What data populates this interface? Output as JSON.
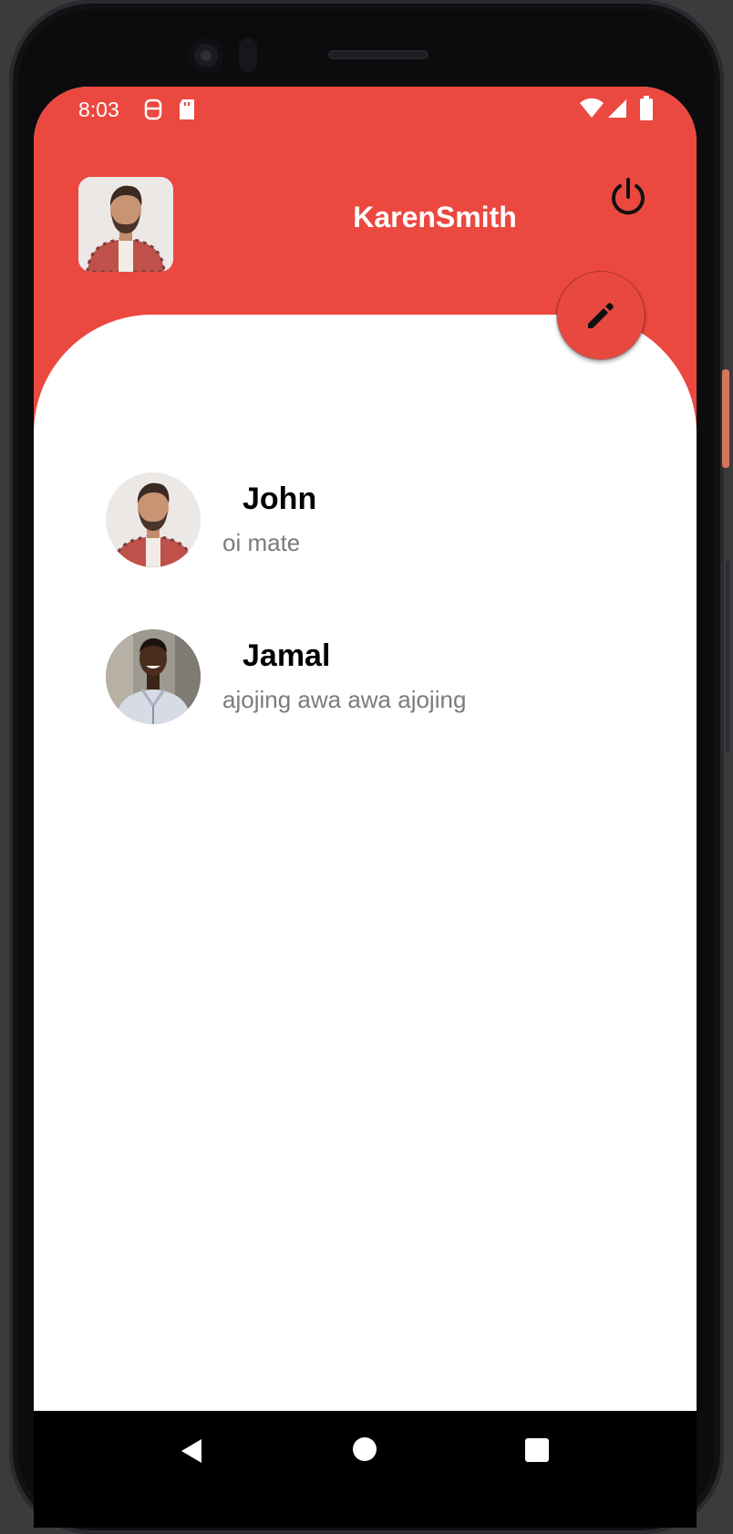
{
  "status_bar": {
    "time": "8:03",
    "left_icons": [
      "sim-toolkit-icon",
      "sd-card-icon"
    ],
    "right_icons": [
      "wifi-icon",
      "cell-signal-icon",
      "battery-icon"
    ]
  },
  "header": {
    "username": "KarenSmith",
    "avatar_icon": "profile-photo",
    "logout_icon": "power-icon",
    "accent_color": "#eb4840"
  },
  "fab": {
    "icon": "edit-pencil-icon"
  },
  "chats": [
    {
      "name": "John",
      "last_message": "oi mate",
      "avatar": "john-photo"
    },
    {
      "name": "Jamal",
      "last_message": "ajojing awa awa ajojing",
      "avatar": "jamal-photo"
    }
  ],
  "nav_bar": {
    "icons": [
      "back-icon",
      "home-icon",
      "recents-icon"
    ]
  }
}
